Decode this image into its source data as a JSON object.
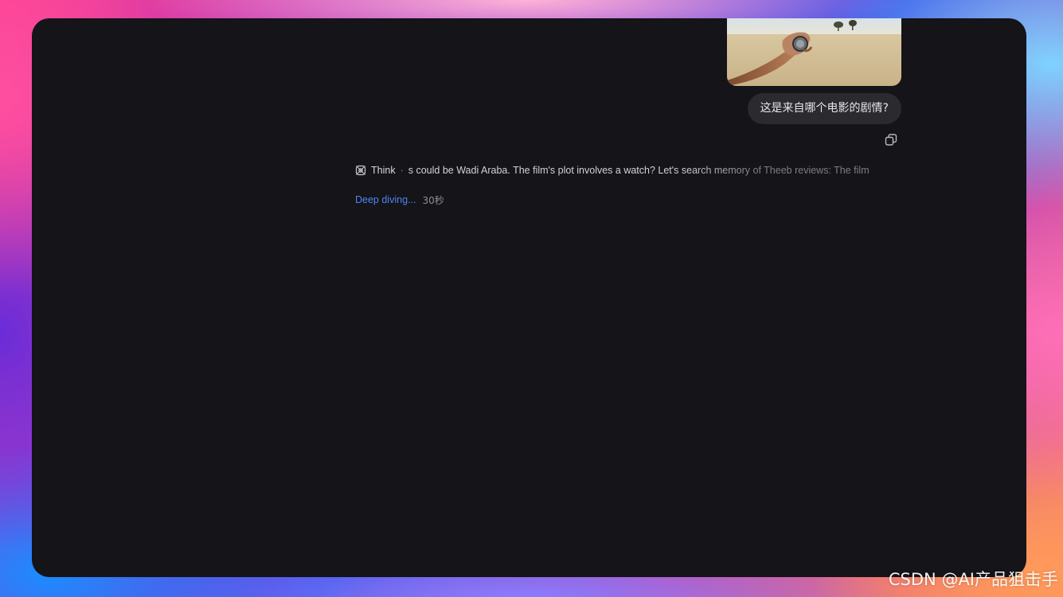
{
  "chat": {
    "image": {
      "description_icon": "photo-thumbnail"
    },
    "user_message": "这是来自哪个电影的剧情?",
    "copy_icon": "copy-icon",
    "thinking": {
      "icon": "think-icon",
      "label": "Think",
      "separator": "·",
      "text": "s could be Wadi Araba. The film's plot involves a watch? Let's search memory of Theeb reviews: The film"
    },
    "status": {
      "label": "Deep diving...",
      "elapsed": "30秒"
    }
  },
  "watermark": "CSDN @AI产品狙击手",
  "colors": {
    "window_bg": "#141419",
    "bubble_bg": "#2a2a2f",
    "link": "#4f86f0"
  }
}
